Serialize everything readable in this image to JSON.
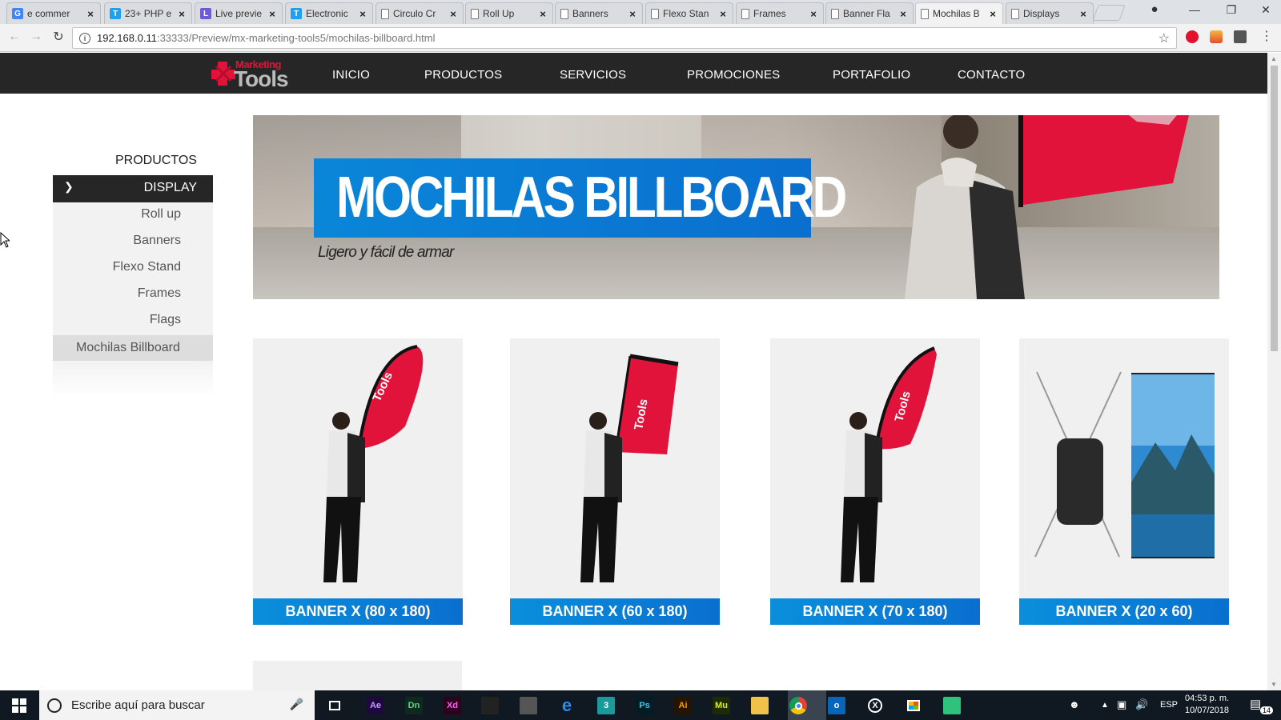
{
  "browser": {
    "tabs": [
      {
        "title": "e commer",
        "favicon": "google-icon",
        "color": "#4285f4",
        "glyph": "G"
      },
      {
        "title": "23+ PHP e",
        "favicon": "t-icon",
        "color": "#1da1f2",
        "glyph": "T"
      },
      {
        "title": "Live previe",
        "favicon": "live-preview-icon",
        "color": "#6d5ad6",
        "glyph": "L"
      },
      {
        "title": "Electronic",
        "favicon": "t-icon",
        "color": "#1da1f2",
        "glyph": "T"
      },
      {
        "title": "Circulo Cr",
        "favicon": "page-icon",
        "color": "",
        "glyph": ""
      },
      {
        "title": "Roll Up",
        "favicon": "page-icon",
        "color": "",
        "glyph": ""
      },
      {
        "title": "Banners",
        "favicon": "page-icon",
        "color": "",
        "glyph": ""
      },
      {
        "title": "Flexo Stan",
        "favicon": "page-icon",
        "color": "",
        "glyph": ""
      },
      {
        "title": "Frames",
        "favicon": "page-icon",
        "color": "",
        "glyph": ""
      },
      {
        "title": "Banner Fla",
        "favicon": "page-icon",
        "color": "",
        "glyph": ""
      },
      {
        "title": "Mochilas B",
        "favicon": "page-icon",
        "color": "",
        "glyph": "",
        "active": true
      },
      {
        "title": "Displays",
        "favicon": "page-icon",
        "color": "",
        "glyph": ""
      }
    ],
    "url_host": "192.168.0.11",
    "url_rest": ":33333/Preview/mx-marketing-tools5/mochilas-billboard.html"
  },
  "site": {
    "logo_top": "Marketing",
    "logo_bottom": "Tools",
    "nav": [
      "INICIO",
      "PRODUCTOS",
      "SERVICIOS",
      "PROMOCIONES",
      "PORTAFOLIO",
      "CONTACTO"
    ]
  },
  "sidebar": {
    "title": "PRODUCTOS",
    "section": "DISPLAY",
    "items": [
      "Roll up",
      "Banners",
      "Flexo Stand",
      "Frames",
      "Flags",
      "Mochilas Billboard"
    ],
    "active_item": "Mochilas Billboard"
  },
  "hero": {
    "title": "MOCHILAS BILLBOARD",
    "subtitle": "Ligero y fácil de armar"
  },
  "products": [
    {
      "label": "BANNER X (80 x 180)"
    },
    {
      "label": "BANNER X (60 x 180)"
    },
    {
      "label": "BANNER X (70 x 180)"
    },
    {
      "label": "BANNER X (20 x 60)"
    }
  ],
  "taskbar": {
    "search_placeholder": "Escribe aquí para buscar",
    "lang": "ESP",
    "time": "04:53 p. m.",
    "date": "10/07/2018",
    "notifications": "14",
    "apps": [
      {
        "name": "task-view-icon",
        "label": "",
        "bg": "transparent",
        "fg": "#fff"
      },
      {
        "name": "after-effects-icon",
        "label": "Ae",
        "bg": "#1f0740",
        "fg": "#c59bff"
      },
      {
        "name": "dimension-icon",
        "label": "Dn",
        "bg": "#0d2a1c",
        "fg": "#5fd18b"
      },
      {
        "name": "xd-icon",
        "label": "Xd",
        "bg": "#2e001f",
        "fg": "#ff61f6"
      },
      {
        "name": "inkscape-icon",
        "label": "",
        "bg": "#222",
        "fg": "#fff"
      },
      {
        "name": "scanner-icon",
        "label": "",
        "bg": "#555",
        "fg": "#fff"
      },
      {
        "name": "edge-icon",
        "label": "e",
        "bg": "transparent",
        "fg": "#2d8de4"
      },
      {
        "name": "3ds-max-icon",
        "label": "3",
        "bg": "#1a9a9a",
        "fg": "#fff"
      },
      {
        "name": "photoshop-icon",
        "label": "Ps",
        "bg": "#001d26",
        "fg": "#31c5f0"
      },
      {
        "name": "illustrator-icon",
        "label": "Ai",
        "bg": "#261300",
        "fg": "#ff9a00"
      },
      {
        "name": "muse-icon",
        "label": "Mu",
        "bg": "#1e2b00",
        "fg": "#d7f500"
      },
      {
        "name": "file-explorer-icon",
        "label": "",
        "bg": "#f0c24b",
        "fg": "#fff"
      },
      {
        "name": "chrome-icon",
        "label": "",
        "bg": "transparent",
        "fg": "#fff"
      },
      {
        "name": "outlook-icon",
        "label": "o",
        "bg": "#0a64b8",
        "fg": "#fff"
      },
      {
        "name": "xbox-icon",
        "label": "",
        "bg": "transparent",
        "fg": "#fff"
      },
      {
        "name": "store-icon",
        "label": "",
        "bg": "transparent",
        "fg": "#fff"
      },
      {
        "name": "app-green-icon",
        "label": "",
        "bg": "#30c17c",
        "fg": "#fff"
      }
    ]
  },
  "colors": {
    "accent_blue": "#0a86d8",
    "brand_red": "#e2133a",
    "header_dark": "#262626"
  }
}
